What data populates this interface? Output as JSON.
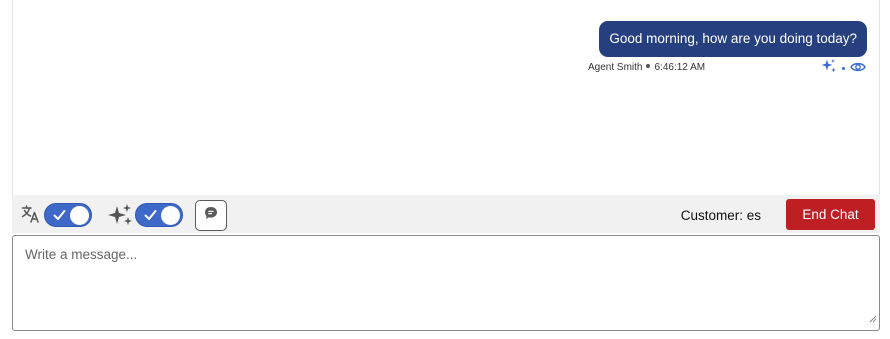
{
  "conversation": {
    "messages": [
      {
        "text": "Good morning, how are you doing today?",
        "author": "Agent Smith",
        "time": "6:46:12 AM",
        "icons": [
          "sparkle-icon",
          "eye-icon"
        ]
      }
    ]
  },
  "toolbar": {
    "translate_toggle": {
      "icon": "translate-icon",
      "on": true
    },
    "ai_toggle": {
      "icon": "sparkle-icon",
      "on": true
    },
    "note_icon": "chat-bubble-icon",
    "customer_language": "Customer: es",
    "end_chat_label": "End Chat"
  },
  "composer": {
    "placeholder": "Write a message...",
    "value": ""
  },
  "colors": {
    "agent_bubble": "#263f7e",
    "toggle_on": "#3e69c9",
    "end_chat": "#bd1f22",
    "toolbar_bg": "#f1f1f1"
  }
}
